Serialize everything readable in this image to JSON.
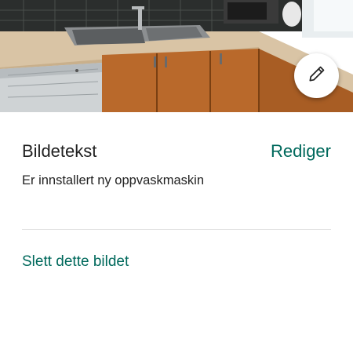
{
  "photo": {
    "alt": "Kitchen with new dishwasher"
  },
  "edit_photo_button": {
    "icon": "pencil-icon"
  },
  "caption": {
    "title": "Bildetekst",
    "edit_label": "Rediger",
    "text": "Er innstallert ny oppvaskmaskin"
  },
  "actions": {
    "delete_label": "Slett dette bildet"
  },
  "colors": {
    "accent": "#00695c",
    "text": "#222222",
    "divider": "#e2e2e2"
  }
}
